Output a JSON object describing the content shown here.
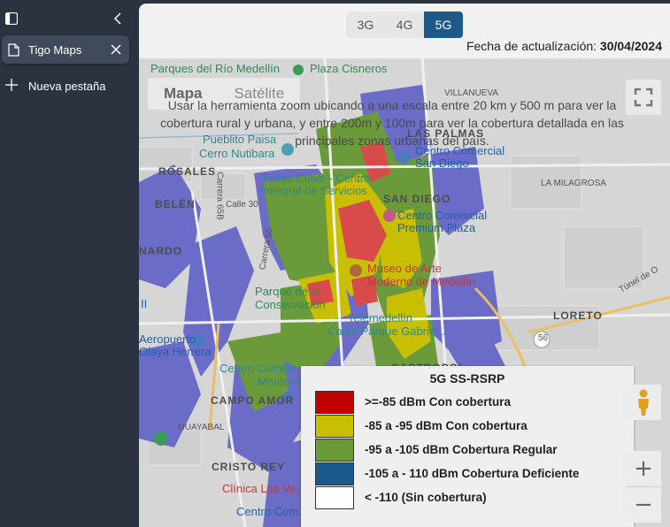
{
  "sidebar": {
    "tab_label": "Tigo Maps",
    "new_tab_label": "Nueva pestaña"
  },
  "network_toggle": {
    "options": [
      "3G",
      "4G",
      "5G"
    ],
    "selected": "5G"
  },
  "update": {
    "label": "Fecha de actualización:",
    "date": "30/04/2024"
  },
  "map": {
    "map_types": [
      "Mapa",
      "Satélite"
    ],
    "notice": "Usar la herramienta zoom ubicando a una escala entre 20 km y 500 m para ver la cobertura rural y urbana, y entre 200m y 100m para ver la cobertura detallada en las principales zonas urbanas del país.",
    "labels": {
      "parques": "Parques del Río Medellín",
      "cisneros": "Plaza Cisneros",
      "villanueva": "VILLANUEVA",
      "las_palmas": "LAS PALMAS",
      "pueblito": "Pueblito Paisa",
      "cc_san_diego_1": "Centro Comercial",
      "cc_san_diego_2": "San Diego",
      "nutibara": "Cerro Nutibara",
      "rosales": "ROSALES",
      "punto_clave_1": "Punto Clave - Centro",
      "punto_clave_2": "Integral de Servicios",
      "la_milagrosa": "LA MILAGROSA",
      "san_diego": "SAN DIEGO",
      "belen": "BELÉN",
      "cc_premium_1": "Centro Comercial",
      "cc_premium_2": "Premium Plaza",
      "nardo": "NARDO",
      "museo_1": "Museo de Arte",
      "museo_2": "Moderno de Medellín",
      "parque_1": "Parque de la",
      "parque_2": "Conservación",
      "loreto": "LORETO",
      "tele_1": "Telemedellín",
      "tele_2": "Canal Parque Gabriel...",
      "aero_1": "Aeropuerto",
      "aero_2": "Olaya Herrera",
      "cc_monterrey_1": "Centro Comercial",
      "cc_monterrey_2": "Monterrey",
      "castropol": "CASTROPOL",
      "campo_amor": "CAMPO AMOR",
      "guayabal": "GUAYABAL",
      "cristo_rey": "CRISTO REY",
      "clinica": "Clínica Las Ve...",
      "cc_bottom": "Centro Com...",
      "calle30": "Calle 30",
      "carrera65": "Carrera 65",
      "carrera65b": "Carrera 65B",
      "tunel": "Túnel de O",
      "road56": "56",
      "ii": "II"
    }
  },
  "legend": {
    "title": "5G SS-RSRP",
    "items": [
      {
        "label": ">=-85 dBm Con cobertura",
        "color": "#c20000"
      },
      {
        "label": "-85 a -95 dBm Con cobertura",
        "color": "#c8bf00"
      },
      {
        "label": "-95 a -105 dBm Cobertura Regular",
        "color": "#6a9a3a"
      },
      {
        "label": "-105 a - 110 dBm Cobertura Deficiente",
        "color": "#1d5a8c"
      },
      {
        "label": "< -110  (Sin cobertura)",
        "color": "#ffffff"
      }
    ]
  },
  "controls": {
    "zoom_in": "+",
    "zoom_out": "−"
  }
}
